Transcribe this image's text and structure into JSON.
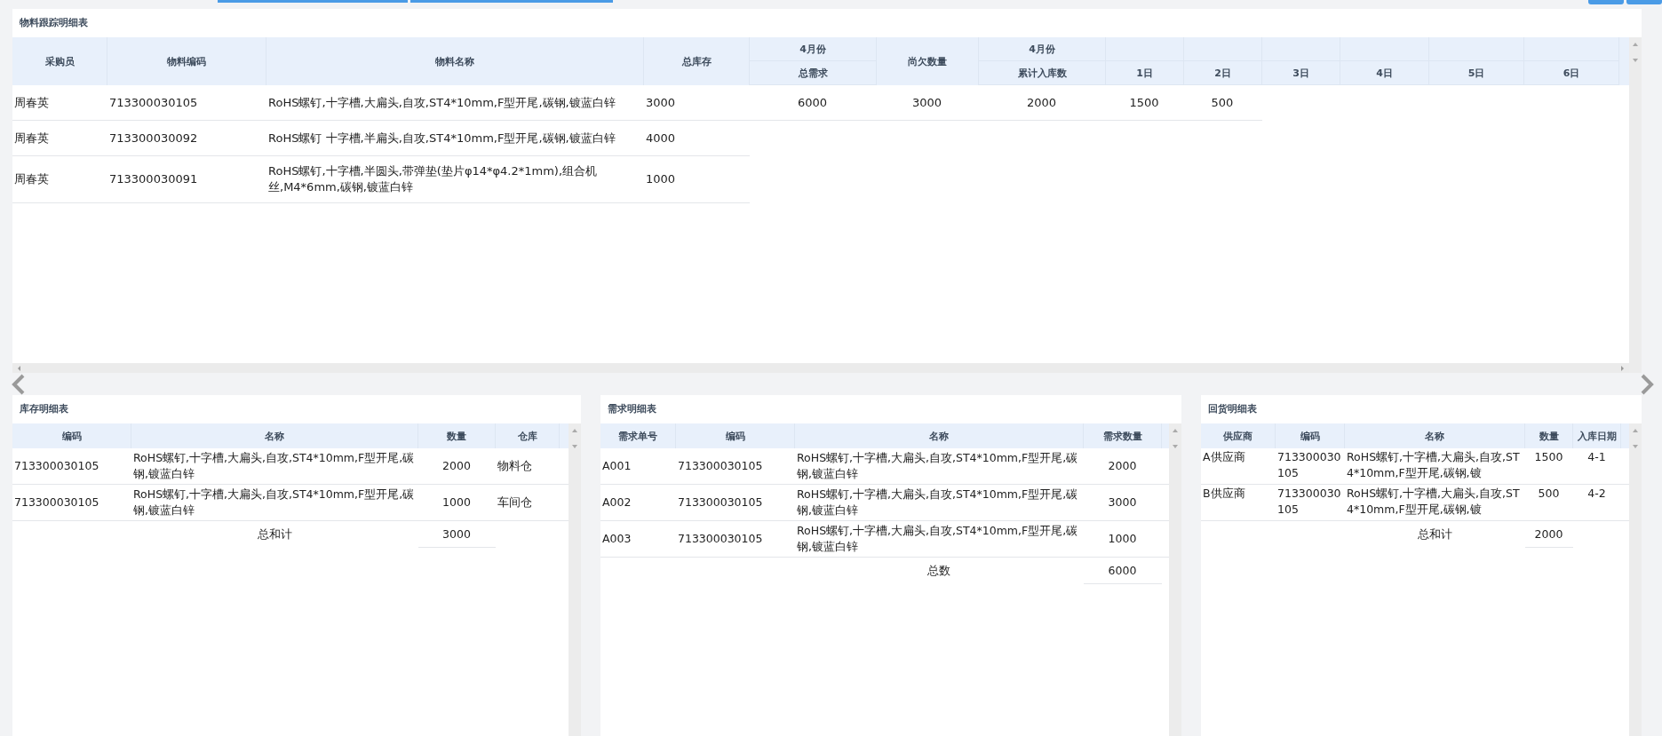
{
  "tracking": {
    "title": "物料跟踪明细表",
    "columns": [
      {
        "kind": "tall",
        "label": "采购员"
      },
      {
        "kind": "tall",
        "label": "物料编码"
      },
      {
        "kind": "tall",
        "label": "物料名称"
      },
      {
        "kind": "tall",
        "label": "总库存"
      },
      {
        "kind": "grouped",
        "group": "4月份",
        "label": "总需求"
      },
      {
        "kind": "tall",
        "label": "尚欠数量"
      },
      {
        "kind": "grouped",
        "group": "4月份",
        "label": "累计入库数"
      },
      {
        "kind": "day",
        "label": "1日"
      },
      {
        "kind": "day",
        "label": "2日"
      },
      {
        "kind": "day",
        "label": "3日"
      },
      {
        "kind": "day",
        "label": "4日"
      },
      {
        "kind": "day",
        "label": "5日"
      },
      {
        "kind": "day",
        "label": "6日"
      }
    ],
    "rows": [
      [
        "周春英",
        "713300030105",
        "RoHS螺钉,十字槽,大扁头,自攻,ST4*10mm,F型开尾,碳钢,镀蓝白锌",
        "3000",
        "6000",
        "3000",
        "2000",
        "1500",
        "500"
      ],
      [
        "周春英",
        "713300030092",
        "RoHS螺钉 十字槽,半扁头,自攻,ST4*10mm,F型开尾,碳钢,镀蓝白锌",
        "4000"
      ],
      [
        "周春英",
        "713300030091",
        "RoHS螺钉,十字槽,半圆头,带弹垫(垫片φ14*φ4.2*1mm),组合机丝,M4*6mm,碳钢,镀蓝白锌",
        "1000"
      ]
    ]
  },
  "panels": [
    {
      "title": "库存明细表",
      "columns": [
        "编码",
        "名称",
        "数量",
        "仓库"
      ],
      "rows": [
        [
          "713300030105",
          "RoHS螺钉,十字槽,大扁头,自攻,ST4*10mm,F型开尾,碳钢,镀蓝白锌",
          "2000",
          "物料仓"
        ],
        [
          "713300030105",
          "RoHS螺钉,十字槽,大扁头,自攻,ST4*10mm,F型开尾,碳钢,镀蓝白锌",
          "1000",
          "车间仓"
        ]
      ],
      "total": {
        "label": "总和计",
        "value": "3000"
      }
    },
    {
      "title": "需求明细表",
      "columns": [
        "需求单号",
        "编码",
        "名称",
        "需求数量"
      ],
      "rows": [
        [
          "A001",
          "713300030105",
          "RoHS螺钉,十字槽,大扁头,自攻,ST4*10mm,F型开尾,碳钢,镀蓝白锌",
          "2000"
        ],
        [
          "A002",
          "713300030105",
          "RoHS螺钉,十字槽,大扁头,自攻,ST4*10mm,F型开尾,碳钢,镀蓝白锌",
          "3000"
        ],
        [
          "A003",
          "713300030105",
          "RoHS螺钉,十字槽,大扁头,自攻,ST4*10mm,F型开尾,碳钢,镀蓝白锌",
          "1000"
        ]
      ],
      "total": {
        "label": "总数",
        "value": "6000"
      }
    },
    {
      "title": "回货明细表",
      "columns": [
        "供应商",
        "编码",
        "名称",
        "数量",
        "入库日期"
      ],
      "rows": [
        [
          "A供应商",
          "713300030105",
          "RoHS螺钉,十字槽,大扁头,自攻,ST4*10mm,F型开尾,碳钢,镀",
          "1500",
          "4-1"
        ],
        [
          "B供应商",
          "713300030105",
          "RoHS螺钉,十字槽,大扁头,自攻,ST4*10mm,F型开尾,碳钢,镀",
          "500",
          "4-2"
        ]
      ],
      "total": {
        "label": "总和计",
        "value": "2000"
      }
    }
  ]
}
